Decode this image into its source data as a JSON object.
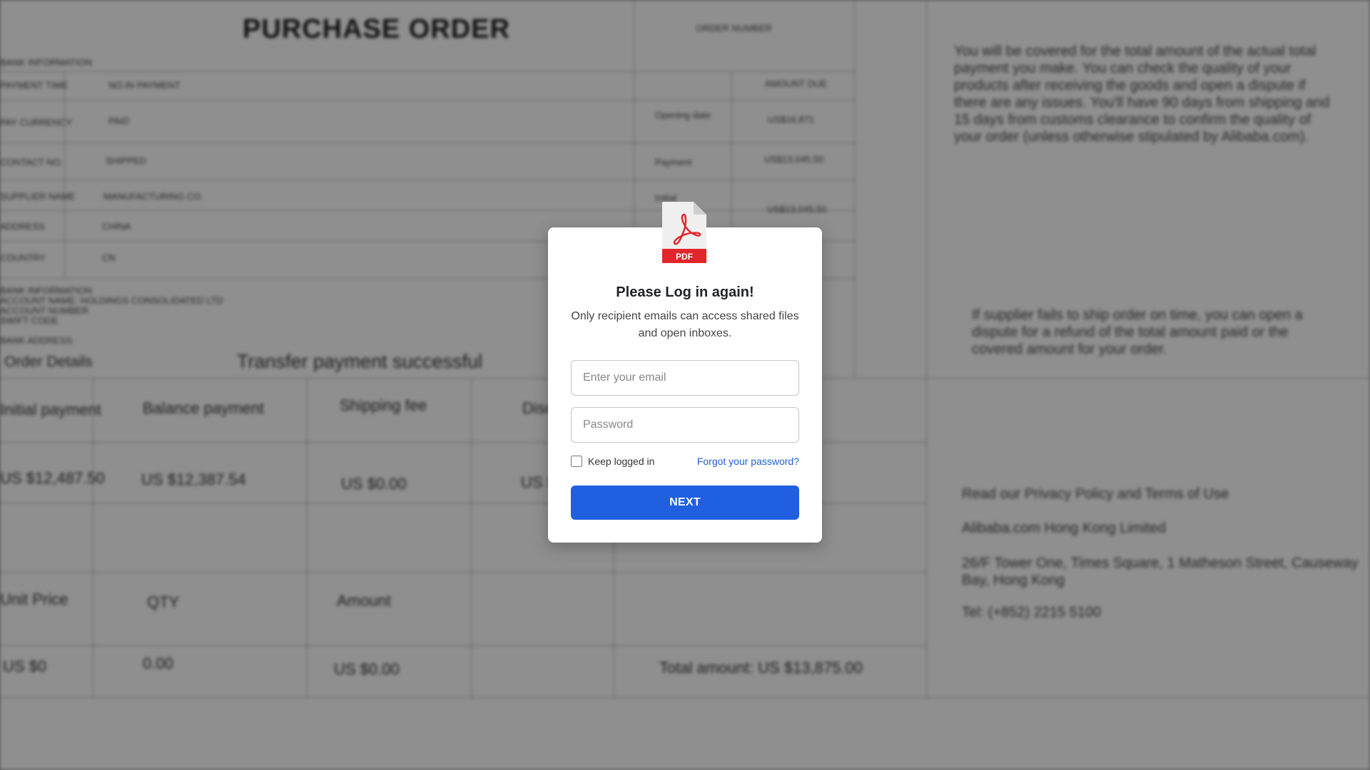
{
  "background_document": {
    "title": "PURCHASE ORDER",
    "header_right": "ORDER NUMBER",
    "row_labels": [
      "PAYMENT TIME",
      "PAY CURRENCY",
      "CONTACT NO.",
      "SUPPLIER NAME",
      "ADDRESS",
      "COUNTRY"
    ],
    "row_values": [
      "NO.IN PAYMENT",
      "PAID",
      "SHIPPED",
      "MANUFACTURING CO",
      "CHINA",
      "CN"
    ],
    "right_col_labels": [
      "",
      "Opening date",
      "Payment",
      "Initial"
    ],
    "right_col_values": [
      "AMOUNT DUE",
      "US$16,871",
      "US$13,045.50",
      "US$13,045.50"
    ],
    "info_lines": [
      "BANK INFORMATION",
      "ACCOUNT NAME: HOLDINGS CONSOLIDATED LTD",
      "ACCOUNT NUMBER",
      "SWIFT CODE",
      "BANK ADDRESS"
    ],
    "order_details_label": "Order Details",
    "transfer_status": "Transfer payment successful",
    "table_headers": [
      "Initial payment",
      "Balance payment",
      "Shipping fee",
      "Disc"
    ],
    "table_values": [
      "US $12,487.50",
      "US $12,387.54",
      "US $0.00",
      "US $"
    ],
    "second_headers": [
      "Unit Price",
      "QTY",
      "Amount"
    ],
    "second_values": [
      "US $0",
      "0.00",
      "US $0.00"
    ],
    "total_amount": "Total amount: US $13,875.00",
    "right_paragraph_1": "You will be covered for the total amount of the actual total payment you make. You can check the quality of your products after receiving the goods and open a dispute if there are any issues. You'll have 90 days from shipping and 15 days from customs clearance to confirm the quality of your order (unless otherwise stipulated by Alibaba.com).",
    "right_paragraph_2": "If supplier fails to ship order on time, you can open a dispute for a refund of the total amount paid or the covered amount for your order.",
    "footer_lines": [
      "Read our Privacy Policy and Terms of Use",
      "Alibaba.com Hong Kong Limited",
      "26/F Tower One, Times Square, 1 Matheson Street, Causeway Bay, Hong Kong",
      "Tel: (+852) 2215 5100"
    ]
  },
  "modal": {
    "icon": "pdf-icon",
    "icon_label": "PDF",
    "title": "Please Log in again!",
    "subtitle": "Only recipient emails can access shared files and open inboxes.",
    "email_placeholder": "Enter your email",
    "password_placeholder": "Password",
    "keep_logged_in_label": "Keep logged in",
    "forgot_password_label": "Forgot your password?",
    "next_button_label": "NEXT",
    "accent_color": "#1f5fe0",
    "pdf_red": "#e0262a"
  }
}
